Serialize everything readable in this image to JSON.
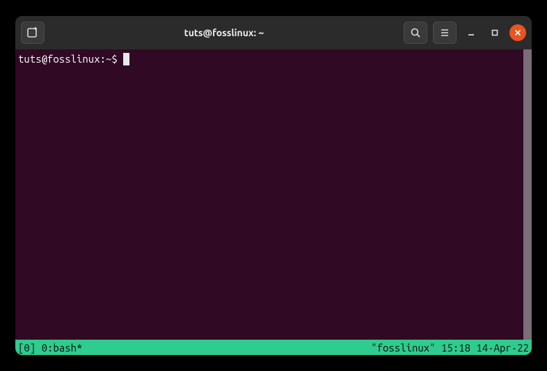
{
  "titlebar": {
    "title": "tuts@fosslinux: ~"
  },
  "terminal": {
    "prompt": "tuts@fosslinux:~$ "
  },
  "statusbar": {
    "left": "[0] 0:bash*",
    "right": "\"fosslinux\" 15:18 14-Apr-22"
  }
}
